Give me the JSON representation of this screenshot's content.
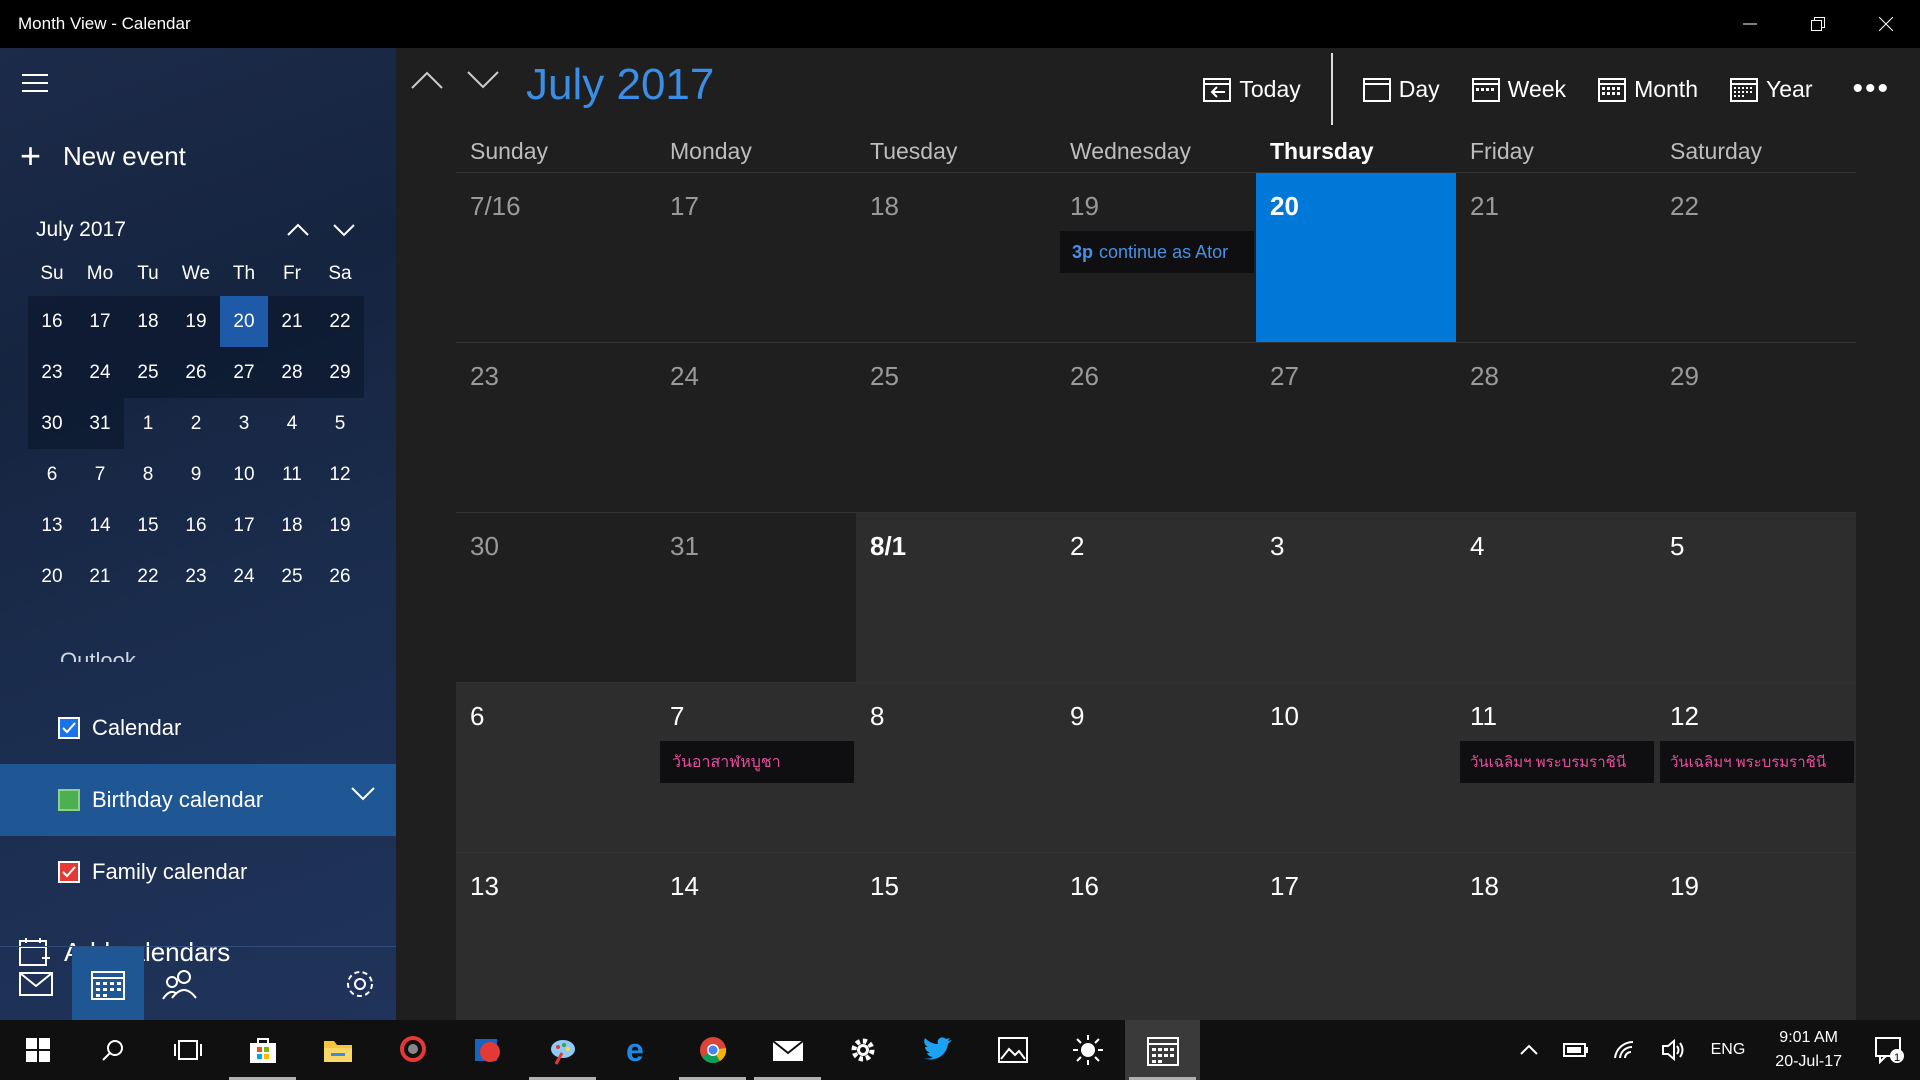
{
  "window": {
    "title": "Month View - Calendar"
  },
  "sidebar": {
    "new_event": "New event",
    "mini_calendar": {
      "label": "July 2017",
      "dow": [
        "Su",
        "Mo",
        "Tu",
        "We",
        "Th",
        "Fr",
        "Sa"
      ],
      "weeks": [
        [
          "16",
          "17",
          "18",
          "19",
          "20",
          "21",
          "22"
        ],
        [
          "23",
          "24",
          "25",
          "26",
          "27",
          "28",
          "29"
        ],
        [
          "30",
          "31",
          "1",
          "2",
          "3",
          "4",
          "5"
        ],
        [
          "6",
          "7",
          "8",
          "9",
          "10",
          "11",
          "12"
        ],
        [
          "13",
          "14",
          "15",
          "16",
          "17",
          "18",
          "19"
        ],
        [
          "20",
          "21",
          "22",
          "23",
          "24",
          "25",
          "26"
        ]
      ]
    },
    "account_label": "Outlook",
    "calendars": [
      {
        "label": "Calendar",
        "checked": true,
        "color": "#1a73e8"
      },
      {
        "label": "Birthday calendar",
        "checked": false,
        "color": "#4caf50"
      },
      {
        "label": "Family calendar",
        "checked": true,
        "color": "#e53935"
      }
    ],
    "add_calendars": "Add calendars"
  },
  "toolbar": {
    "month_title": "July 2017",
    "today": "Today",
    "day": "Day",
    "week": "Week",
    "month": "Month",
    "year": "Year"
  },
  "month_view": {
    "dow": [
      "Sunday",
      "Monday",
      "Tuesday",
      "Wednesday",
      "Thursday",
      "Friday",
      "Saturday"
    ],
    "weeks": [
      [
        "7/16",
        "17",
        "18",
        "19",
        "20",
        "21",
        "22"
      ],
      [
        "23",
        "24",
        "25",
        "26",
        "27",
        "28",
        "29"
      ],
      [
        "30",
        "31",
        "8/1",
        "2",
        "3",
        "4",
        "5"
      ],
      [
        "6",
        "7",
        "8",
        "9",
        "10",
        "11",
        "12"
      ],
      [
        "13",
        "14",
        "15",
        "16",
        "17",
        "18",
        "19"
      ]
    ],
    "events": {
      "wed19": {
        "time": "3p",
        "title": "continue  as Ator"
      },
      "mon7": {
        "title": "วันอาสาฬหบูชา"
      },
      "fri11": {
        "title": "วันเฉลิมฯ พระบรมราชินี"
      },
      "sat12": {
        "title": "วันเฉลิมฯ พระบรมราชินี"
      }
    }
  },
  "taskbar": {
    "lang": "ENG",
    "time": "9:01 AM",
    "date": "20-Jul-17",
    "notifications": "1"
  },
  "colors": {
    "accent": "#0078d7",
    "title_blue": "#3a8ee6",
    "event_pink": "#e64d9a"
  }
}
